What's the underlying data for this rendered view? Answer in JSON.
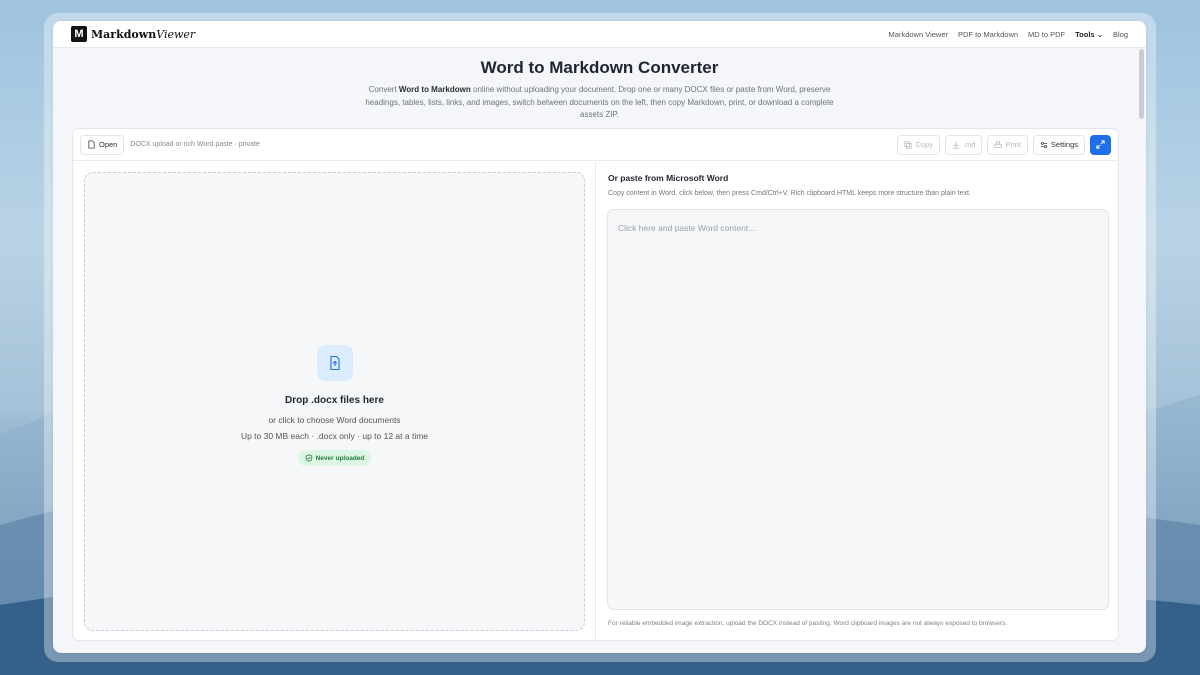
{
  "nav": {
    "logo_mark": "M",
    "logo_main": "Markdown",
    "logo_italic": "Viewer",
    "links": [
      "Markdown Viewer",
      "PDF to Markdown",
      "MD to PDF",
      "Tools",
      "Blog"
    ]
  },
  "hero": {
    "title": "Word to Markdown Converter",
    "desc_pre": "Convert ",
    "desc_bold": "Word to Markdown",
    "desc_post": " online without uploading your document. Drop one or many DOCX files or paste from Word, preserve headings, tables, lists, links, and images, switch between documents on the left, then copy Markdown, print, or download a complete assets ZIP."
  },
  "toolbar": {
    "open_label": "Open",
    "meta": "DOCX upload or rich Word paste · private",
    "copy_label": "Copy",
    "md_label": ".md",
    "print_label": "Print",
    "settings_label": "Settings"
  },
  "drop": {
    "title": "Drop .docx files here",
    "sub": "or click to choose Word documents",
    "limits": "Up to 30 MB each · .docx only · up to 12 at a time",
    "badge": "Never uploaded"
  },
  "paste": {
    "heading": "Or paste from Microsoft Word",
    "help": "Copy content in Word, click below, then press Cmd/Ctrl+V. Rich clipboard HTML keeps more structure than plain text.",
    "placeholder": "Click here and paste Word content...",
    "footer": "For reliable embedded image extraction, upload the DOCX instead of pasting. Word clipboard images are not always exposed to browsers."
  },
  "colors": {
    "accent": "#1f6feb",
    "badge_bg": "#dcf6e3",
    "badge_text": "#237a3f"
  }
}
